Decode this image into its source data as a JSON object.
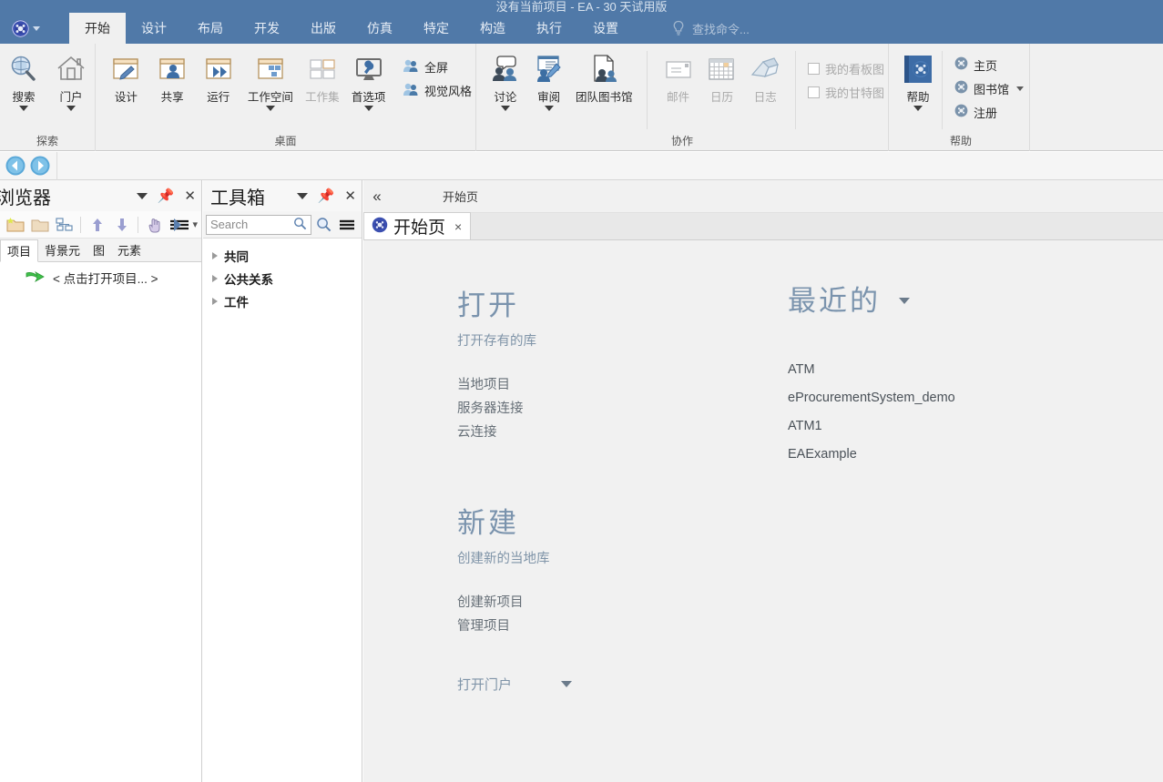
{
  "window": {
    "title": "没有当前项目 - EA - 30 天试用版",
    "accent_blue": "#5079a8",
    "ribbon_bg": "#f0f0f0"
  },
  "ribbon": {
    "tabs": [
      {
        "label": "开始",
        "active": true
      },
      {
        "label": "设计",
        "active": false
      },
      {
        "label": "布局",
        "active": false
      },
      {
        "label": "开发",
        "active": false
      },
      {
        "label": "出版",
        "active": false
      },
      {
        "label": "仿真",
        "active": false
      },
      {
        "label": "特定",
        "active": false
      },
      {
        "label": "构造",
        "active": false
      },
      {
        "label": "执行",
        "active": false
      },
      {
        "label": "设置",
        "active": false
      }
    ],
    "search_command_placeholder": "查找命令...",
    "groups": [
      {
        "label": "探索",
        "buttons": [
          {
            "label": "搜索",
            "icon": "magnifier-icon",
            "caret": true,
            "disabled": false
          },
          {
            "label": "门户",
            "icon": "house-icon",
            "caret": true,
            "disabled": false
          }
        ]
      },
      {
        "label": "桌面",
        "buttons": [
          {
            "label": "设计",
            "icon": "window-pencil-icon",
            "caret": false,
            "disabled": false
          },
          {
            "label": "共享",
            "icon": "window-person-icon",
            "caret": false,
            "disabled": false
          },
          {
            "label": "运行",
            "icon": "window-play-icon",
            "caret": false,
            "disabled": false
          },
          {
            "label": "工作空间",
            "icon": "window-shapes-icon",
            "caret": true,
            "disabled": false
          },
          {
            "label": "工作集",
            "icon": "grid-panes-icon",
            "caret": false,
            "disabled": true
          },
          {
            "label": "首选项",
            "icon": "monitor-wrench-icon",
            "caret": true,
            "disabled": false
          }
        ],
        "small_buttons": [
          {
            "label": "全屏",
            "icon": "person-blue-icon",
            "disabled": false
          },
          {
            "label": "视觉风格",
            "icon": "person-blue-icon",
            "disabled": false
          }
        ]
      },
      {
        "label": "协作",
        "buttons": [
          {
            "label": "讨论",
            "icon": "people-chat-icon",
            "caret": true,
            "disabled": false
          },
          {
            "label": "审阅",
            "icon": "review-pencil-icon",
            "caret": true,
            "disabled": false
          },
          {
            "label": "团队图书馆",
            "icon": "doc-people-icon",
            "caret": false,
            "disabled": false
          },
          {
            "label": "邮件",
            "icon": "envelope-icon",
            "caret": false,
            "disabled": true
          },
          {
            "label": "日历",
            "icon": "calendar-icon",
            "caret": false,
            "disabled": true
          },
          {
            "label": "日志",
            "icon": "book-icon",
            "caret": false,
            "disabled": true
          }
        ],
        "check_items": [
          {
            "label": "我的看板图",
            "checked": false,
            "disabled": true
          },
          {
            "label": "我的甘特图",
            "checked": false,
            "disabled": true
          }
        ]
      },
      {
        "label": "帮助",
        "buttons": [
          {
            "label": "帮助",
            "icon": "help-book-icon",
            "caret": true,
            "disabled": false
          }
        ],
        "small_buttons": [
          {
            "label": "主页",
            "icon": "ea-orb-icon",
            "caret": false
          },
          {
            "label": "图书馆",
            "icon": "ea-orb-icon",
            "caret": true
          },
          {
            "label": "注册",
            "icon": "ea-orb-icon",
            "caret": false
          }
        ]
      }
    ]
  },
  "navbar": {
    "back": "back-arrow-icon",
    "forward": "forward-arrow-icon"
  },
  "browser_panel": {
    "title": "浏览器",
    "header_buttons": [
      "chevron-down-icon",
      "pin-icon",
      "close-icon"
    ],
    "toolbar_icons": [
      "new-folder-icon",
      "folder-icon",
      "model-structure-icon",
      "move-up-icon",
      "move-down-icon",
      "hand-pointer-icon",
      "filter-lines-icon"
    ],
    "tabs": [
      {
        "label": "项目",
        "active": true
      },
      {
        "label": "背景元",
        "active": false
      },
      {
        "label": "图",
        "active": false
      },
      {
        "label": "元素",
        "active": false
      }
    ],
    "tree_root": "< 点击打开项目... >"
  },
  "toolbox_panel": {
    "title": "工具箱",
    "header_buttons": [
      "chevron-down-icon",
      "pin-icon",
      "close-icon"
    ],
    "search_placeholder": "Search",
    "search_value": "",
    "toolbar_icons": [
      "search-magnifier-icon",
      "hamburger-menu-icon"
    ],
    "items": [
      {
        "label": "共同"
      },
      {
        "label": "公共关系"
      },
      {
        "label": "工件"
      }
    ]
  },
  "main": {
    "breadcrumb": "开始页",
    "collapse_icon": "double-chevron-left-icon",
    "document_tab": {
      "label": "开始页",
      "icon": "ea-orb-icon",
      "close": "×"
    },
    "start_page": {
      "open": {
        "heading": "打开",
        "subheading": "打开存有的库",
        "links": [
          "当地项目",
          "服务器连接",
          "云连接"
        ]
      },
      "create": {
        "heading": "新建",
        "subheading": "创建新的当地库",
        "links": [
          "创建新项目",
          "管理项目"
        ],
        "portal_label": "打开门户"
      },
      "recent": {
        "heading": "最近的",
        "items": [
          "ATM",
          "eProcurementSystem_demo",
          "ATM1",
          "EAExample"
        ]
      }
    }
  }
}
